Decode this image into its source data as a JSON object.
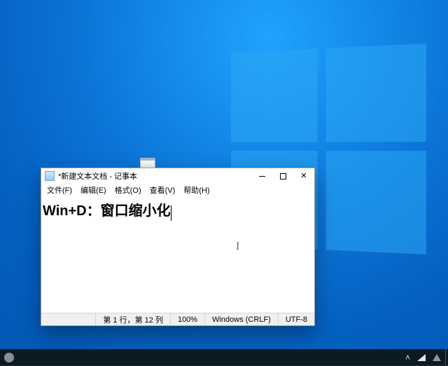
{
  "window": {
    "title": "*新建文本文档 - 记事本"
  },
  "menubar": {
    "file": "文件(F)",
    "edit": "编辑(E)",
    "format": "格式(O)",
    "view": "查看(V)",
    "help": "帮助(H)"
  },
  "editor": {
    "content": "Win+D：窗口缩小化"
  },
  "statusbar": {
    "position": "第 1 行，第 12 列",
    "zoom": "100%",
    "eol": "Windows (CRLF)",
    "encoding": "UTF-8"
  }
}
